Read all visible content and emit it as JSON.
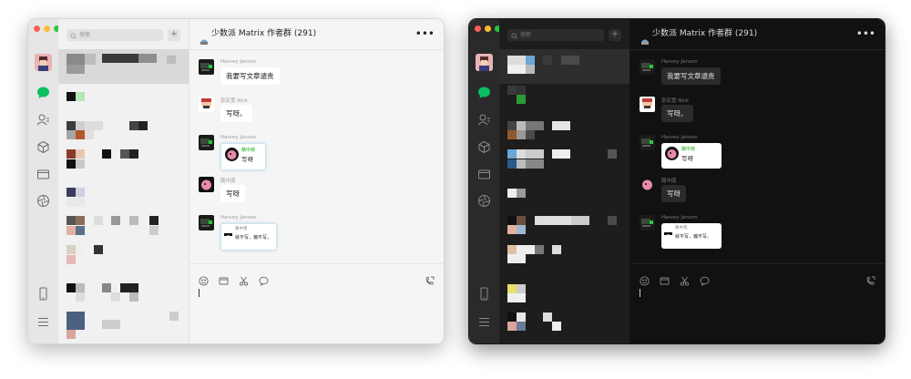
{
  "search_placeholder": "搜索",
  "plus_label": "+",
  "chat": {
    "title": "少数派 Matrix 作者群 (291)",
    "more_label": "•••",
    "messages": [
      {
        "sender": "Harvey Janson",
        "text": "我要写文章谴责"
      },
      {
        "sender": "张宏宽 Nick",
        "text": "写呀。"
      },
      {
        "sender": "Harvey Janson",
        "quote_name": "路中南",
        "quote_text": "写呀"
      },
      {
        "sender": "路中南",
        "text": "写呀"
      },
      {
        "sender": "Harvey Janson",
        "quote_name": "路中南",
        "quote_text": "就不写，偏不写。"
      }
    ]
  },
  "colors": {
    "accent_green": "#07c160",
    "traffic_red": "#fe5f57",
    "traffic_yellow": "#febc2e",
    "traffic_green": "#28c840"
  },
  "icons": [
    "chat-bubble-icon",
    "contacts-icon",
    "cube-icon",
    "folder-icon",
    "aperture-icon",
    "phone-icon",
    "menu-icon",
    "emoji-icon",
    "scissors-icon",
    "call-icon",
    "search-icon"
  ]
}
